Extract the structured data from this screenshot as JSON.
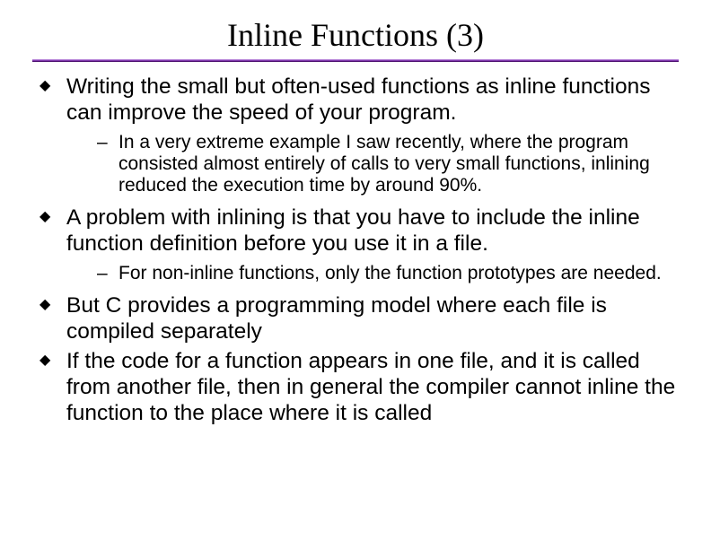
{
  "title": "Inline Functions (3)",
  "bullets": {
    "b1": "Writing the small but often-used functions as inline functions can improve the speed of your program.",
    "b1s1": "In a very extreme example I saw recently, where the program consisted almost entirely of calls to very small functions, inlining reduced the execution time by around 90%.",
    "b2": "A problem with inlining is that you have to include the inline function definition before you use it in a file.",
    "b2s1": "For non-inline functions, only the function prototypes are needed.",
    "b3": "But C provides a programming model where each file is compiled separately",
    "b4": "If the code for a function appears in one file, and it is called from another file, then in general the compiler cannot inline the function to the place where it is called"
  }
}
